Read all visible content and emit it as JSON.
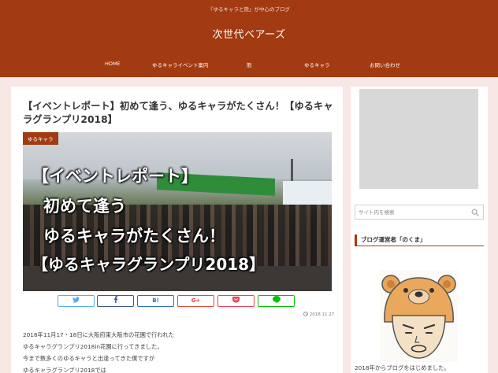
{
  "header": {
    "tagline": "『ゆるキャラと熊』が中心のブログ",
    "title": "次世代ベアーズ"
  },
  "nav": {
    "items": [
      "HOME",
      "ゆるキャライベント案内",
      "熊",
      "ゆるキャラ",
      "お問い合わせ"
    ]
  },
  "post": {
    "title": "【イベントレポート】初めて逢う、ゆるキャラがたくさん！【ゆるキャラグランプリ2018】",
    "category": "ゆるキャラ",
    "hero_lines": [
      "【イベントレポート】",
      "初めて逢う",
      "ゆるキャラがたくさん！",
      "【ゆるキャラグランプリ2018】"
    ],
    "date": "2018.11.27",
    "body_lines": [
      "2018年11月17・18日に大阪府東大阪市の花園で行われた",
      "ゆるキャラグランプリ2018in花園に行ってきました。",
      "今まで数多くのゆるキャラと出逢ってきた僕ですが",
      "ゆるキャラグランプリ2018では"
    ]
  },
  "share": {
    "twitter_color": "#55acee",
    "facebook_color": "#3b5998",
    "hatena_label": "B!",
    "hatena_color": "#2c6ebd",
    "google_label": "G+",
    "google_color": "#dd4b39",
    "pocket_color": "#ef4056",
    "line_color": "#00c300"
  },
  "sidebar": {
    "search_placeholder": "サイト内を検索",
    "profile_title": "ブログ運営者「のくま」",
    "profile_text": "2018年からブログをはじめました。"
  },
  "colors": {
    "brand": "#a23a12",
    "background": "#f7e8e5"
  }
}
